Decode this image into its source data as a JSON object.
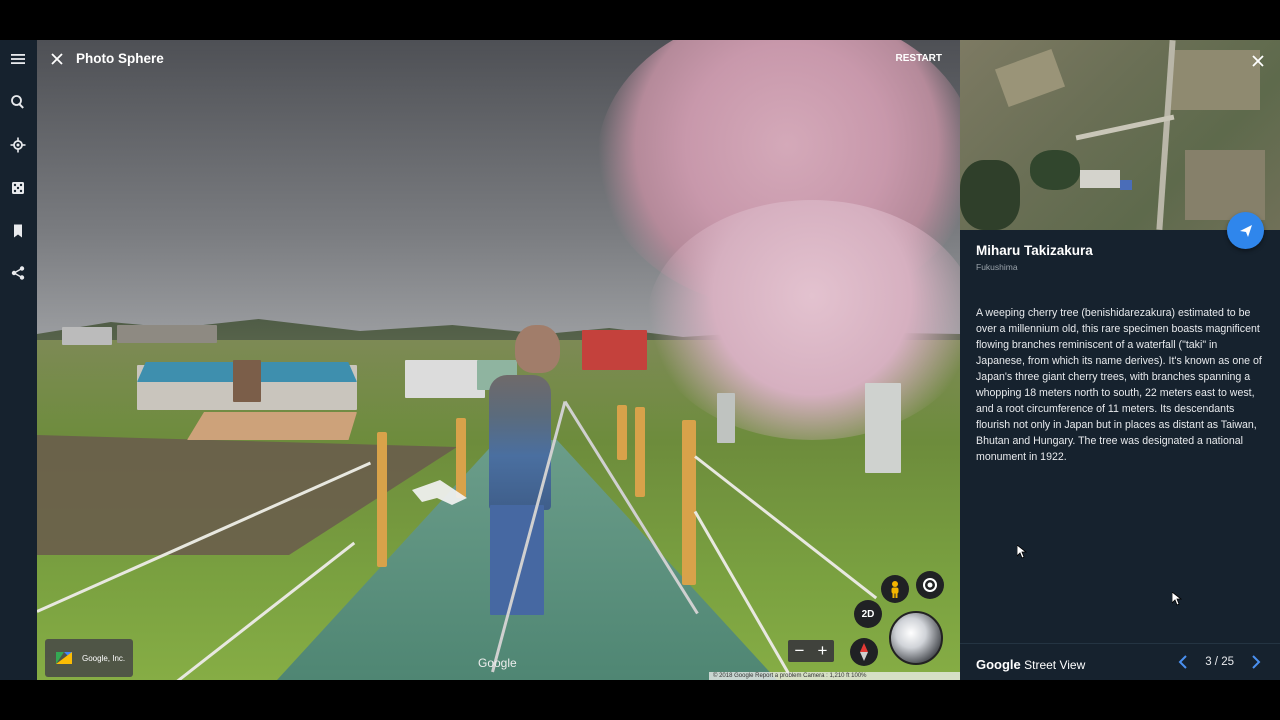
{
  "rail": {
    "items": [
      "menu-icon",
      "search-icon",
      "voyager-icon",
      "feeling-lucky-icon",
      "bookmark-icon",
      "share-icon"
    ]
  },
  "viewer": {
    "title": "Photo Sphere",
    "restart_label": "RESTART",
    "attribution": "Google, Inc.",
    "watermark": "Google",
    "footer_text": "© 2018 Google   Report a problem   Camera : 1,210 ft  100%",
    "mode_2d_label": "2D",
    "zoom_out_label": "−",
    "zoom_in_label": "+"
  },
  "panel": {
    "place_name": "Miharu Takizakura",
    "region": "Fukushima",
    "description": "A weeping cherry tree (benishidarezakura) estimated to be over a millennium old, this rare specimen boasts magnificent flowing branches reminiscent of a waterfall (\"taki\" in Japanese, from which its name derives). It's known as one of Japan's three giant cherry trees, with branches spanning a whopping 18 meters north to south, 22 meters east to west, and a root circumference of 11 meters. Its descendants flourish not only in Japan but in places as distant as Taiwan, Bhutan and Hungary. The tree was designated a national monument in 1922.",
    "brand_google": "Google",
    "brand_product": "Street View",
    "pager": "3 / 25"
  },
  "colors": {
    "panel_bg": "#16222e",
    "accent_blue": "#2f86ec",
    "pager_arrow": "#4a90f0"
  }
}
